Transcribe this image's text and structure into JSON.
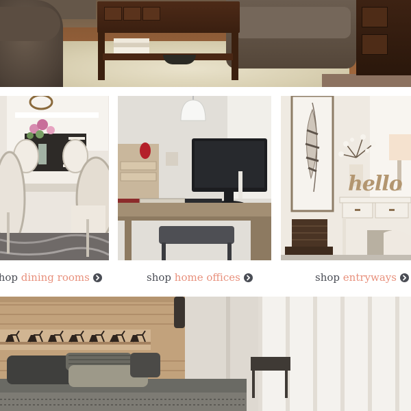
{
  "banner_top": {
    "image": "living-room-furniture-banner"
  },
  "tiles": [
    {
      "shop_label": "shop",
      "category": "dining rooms",
      "arrow_icon": "circle-chevron-right-icon",
      "image": "dining-room-tile"
    },
    {
      "shop_label": "shop",
      "category": "home offices",
      "arrow_icon": "circle-chevron-right-icon",
      "image": "home-office-tile"
    },
    {
      "shop_label": "shop",
      "category": "entryways",
      "arrow_icon": "circle-chevron-right-icon",
      "image": "entryway-tile"
    }
  ],
  "entryway_sign_text": "hello",
  "banner_bottom": {
    "image": "bedroom-banner"
  },
  "colors": {
    "link_text": "#4a4d55",
    "link_accent": "#e8907c",
    "background": "#ffffff"
  }
}
